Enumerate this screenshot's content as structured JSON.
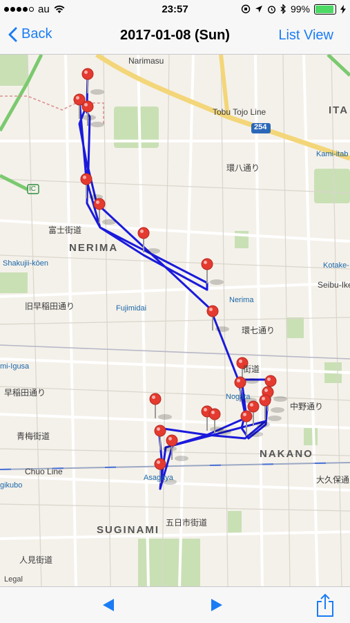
{
  "status": {
    "carrier": "au",
    "time": "23:57",
    "battery": "99%",
    "battery_level": 0.99
  },
  "nav": {
    "back_label": "Back",
    "title": "2017-01-08 (Sun)",
    "list_view_label": "List View"
  },
  "map": {
    "labels": {
      "narimasu": "Narimasu",
      "tobu_tojo": "Tobu Tojo Line",
      "route254": "254",
      "ita": "ITA",
      "kami_itabashi": "Kami-itab",
      "nerima_area": "NERIMA",
      "shakujii": "Shakujii-kōen",
      "fujimidai": "Fujimidai",
      "nerima_station": "Nerima",
      "kotake": "Kotake-",
      "seibu_ikebukuro": "Seibu-Ikeb",
      "nogata": "Nogata",
      "nakano_area": "NAKANO",
      "chuo_line": "Chuo Line",
      "asagaya": "Asagaya",
      "suginami_area": "SUGINAMI",
      "ogikubo": "gikubo",
      "igusa": "mi-Igusa",
      "ic": "IC",
      "fujikaido": "富士街道",
      "ekihachi": "環八通り",
      "waseda1": "早稲田通り",
      "waseda2": "旧早稲田通り",
      "aome": "青梅街道",
      "itsukaichi": "五日市街道",
      "ome2": "人見街道",
      "kanana": "環七通り",
      "nakano_dori": "中野通り",
      "okubo": "大久保通り",
      "shin_ome": "街道"
    },
    "legal": "Legal"
  },
  "toolbar": {
    "prev": "previous-day",
    "next": "next-day",
    "share": "share"
  }
}
